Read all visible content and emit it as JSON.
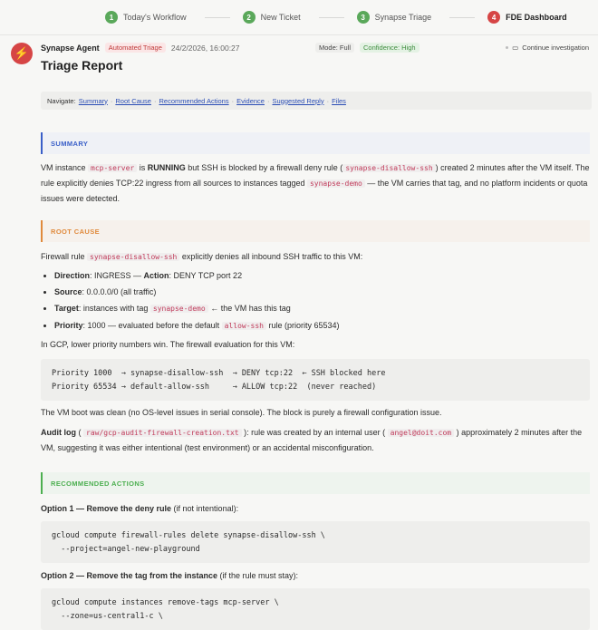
{
  "steps": [
    {
      "num": "1",
      "label": "Today's Workflow",
      "state": "done"
    },
    {
      "num": "2",
      "label": "New Ticket",
      "state": "done"
    },
    {
      "num": "3",
      "label": "Synapse Triage",
      "state": "done"
    },
    {
      "num": "4",
      "label": "FDE Dashboard",
      "state": "active"
    }
  ],
  "header": {
    "agent": "Synapse Agent",
    "badge": "Automated Triage",
    "timestamp": "24/2/2026, 16:00:27",
    "mode": "Mode: Full",
    "confidence": "Confidence: High",
    "continue": "Continue investigation",
    "title": "Triage Report"
  },
  "nav": {
    "label": "Navigate:",
    "links": [
      "Summary",
      "Root Cause",
      "Recommended Actions",
      "Evidence",
      "Suggested Reply",
      "Files"
    ]
  },
  "summary": {
    "heading": "SUMMARY",
    "t1": "VM instance ",
    "c1": "mcp-server",
    "t2": " is ",
    "b1": "RUNNING",
    "t3": " but SSH is blocked by a firewall deny rule (",
    "c2": "synapse-disallow-ssh",
    "t4": ") created 2 minutes after the VM itself. The rule explicitly denies TCP:22 ingress from all sources to instances tagged ",
    "c3": "synapse-demo",
    "t5": " — the VM carries that tag, and no platform incidents or quota issues were detected."
  },
  "root_cause": {
    "heading": "ROOT CAUSE",
    "intro_a": "Firewall rule ",
    "intro_code": "synapse-disallow-ssh",
    "intro_b": " explicitly denies all inbound SSH traffic to this VM:",
    "b1_l1": "Direction",
    "b1_t1": ": INGRESS — ",
    "b1_l2": "Action",
    "b1_t2": ": DENY TCP port 22",
    "b2_l": "Source",
    "b2_t": ": 0.0.0.0/0 (all traffic)",
    "b3_l": "Target",
    "b3_t": ": instances with tag ",
    "b3_code": "synapse-demo",
    "b3_t2": " ← the VM has this tag",
    "b4_l": "Priority",
    "b4_t": ": 1000 — evaluated before the default ",
    "b4_code": "allow-ssh",
    "b4_t2": " rule (priority 65534)",
    "gcp_note": "In GCP, lower priority numbers win. The firewall evaluation for this VM:",
    "code_block": "Priority 1000  → synapse-disallow-ssh  → DENY tcp:22  ← SSH blocked here\nPriority 65534 → default-allow-ssh     → ALLOW tcp:22  (never reached)",
    "boot_note": "The VM boot was clean (no OS-level issues in serial console). The block is purely a firewall configuration issue.",
    "audit_l": "Audit log",
    "audit_t1": " ( ",
    "audit_code": "raw/gcp-audit-firewall-creation.txt",
    "audit_t2": " ): rule was created by an internal user ( ",
    "audit_user": "angel@doit.com",
    "audit_t3": " ) approximately 2 minutes after the VM, suggesting it was either intentional (test environment) or an accidental misconfiguration."
  },
  "actions": {
    "heading": "RECOMMENDED ACTIONS",
    "opt1_b": "Option 1 — Remove the deny rule",
    "opt1_t": " (if not intentional):",
    "opt1_code": "gcloud compute firewall-rules delete synapse-disallow-ssh \\\n  --project=angel-new-playground",
    "opt2_b": "Option 2 — Remove the tag from the instance",
    "opt2_t": " (if the rule must stay):",
    "opt2_code": "gcloud compute instances remove-tags mcp-server \\\n  --zone=us-central1-c \\"
  },
  "colors": {
    "summary": "#3a5fc8",
    "root_cause": "#e08a3c",
    "actions": "#4caf50",
    "active_step": "#d64545",
    "done_step": "#5aa85a"
  }
}
